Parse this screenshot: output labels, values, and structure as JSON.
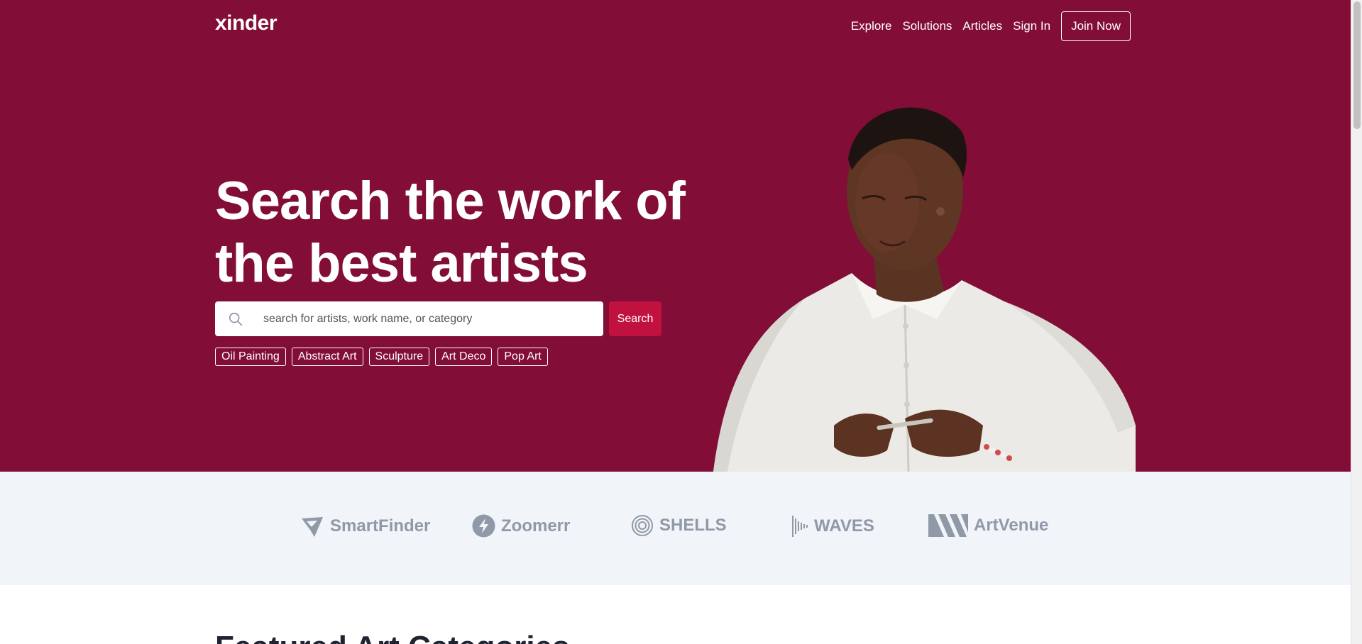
{
  "header": {
    "logo": "xinder",
    "nav": [
      "Explore",
      "Solutions",
      "Articles",
      "Sign In"
    ],
    "join_label": "Join Now"
  },
  "hero": {
    "headline_line1": "Search the work of",
    "headline_line2": "the best artists",
    "search_placeholder": "search for artists, work name, or category",
    "search_button": "Search",
    "tags": [
      "Oil Painting",
      "Abstract Art",
      "Sculpture",
      "Art Deco",
      "Pop Art"
    ]
  },
  "partners": [
    "SmartFinder",
    "Zoomerr",
    "SHELLS",
    "WAVES",
    "ArtVenue"
  ],
  "featured": {
    "title": "Featured Art Categories"
  },
  "colors": {
    "brand": "#820d36",
    "accent": "#c1123f",
    "strip_bg": "#f1f4f8",
    "logo_gray": "#8f99a8"
  }
}
